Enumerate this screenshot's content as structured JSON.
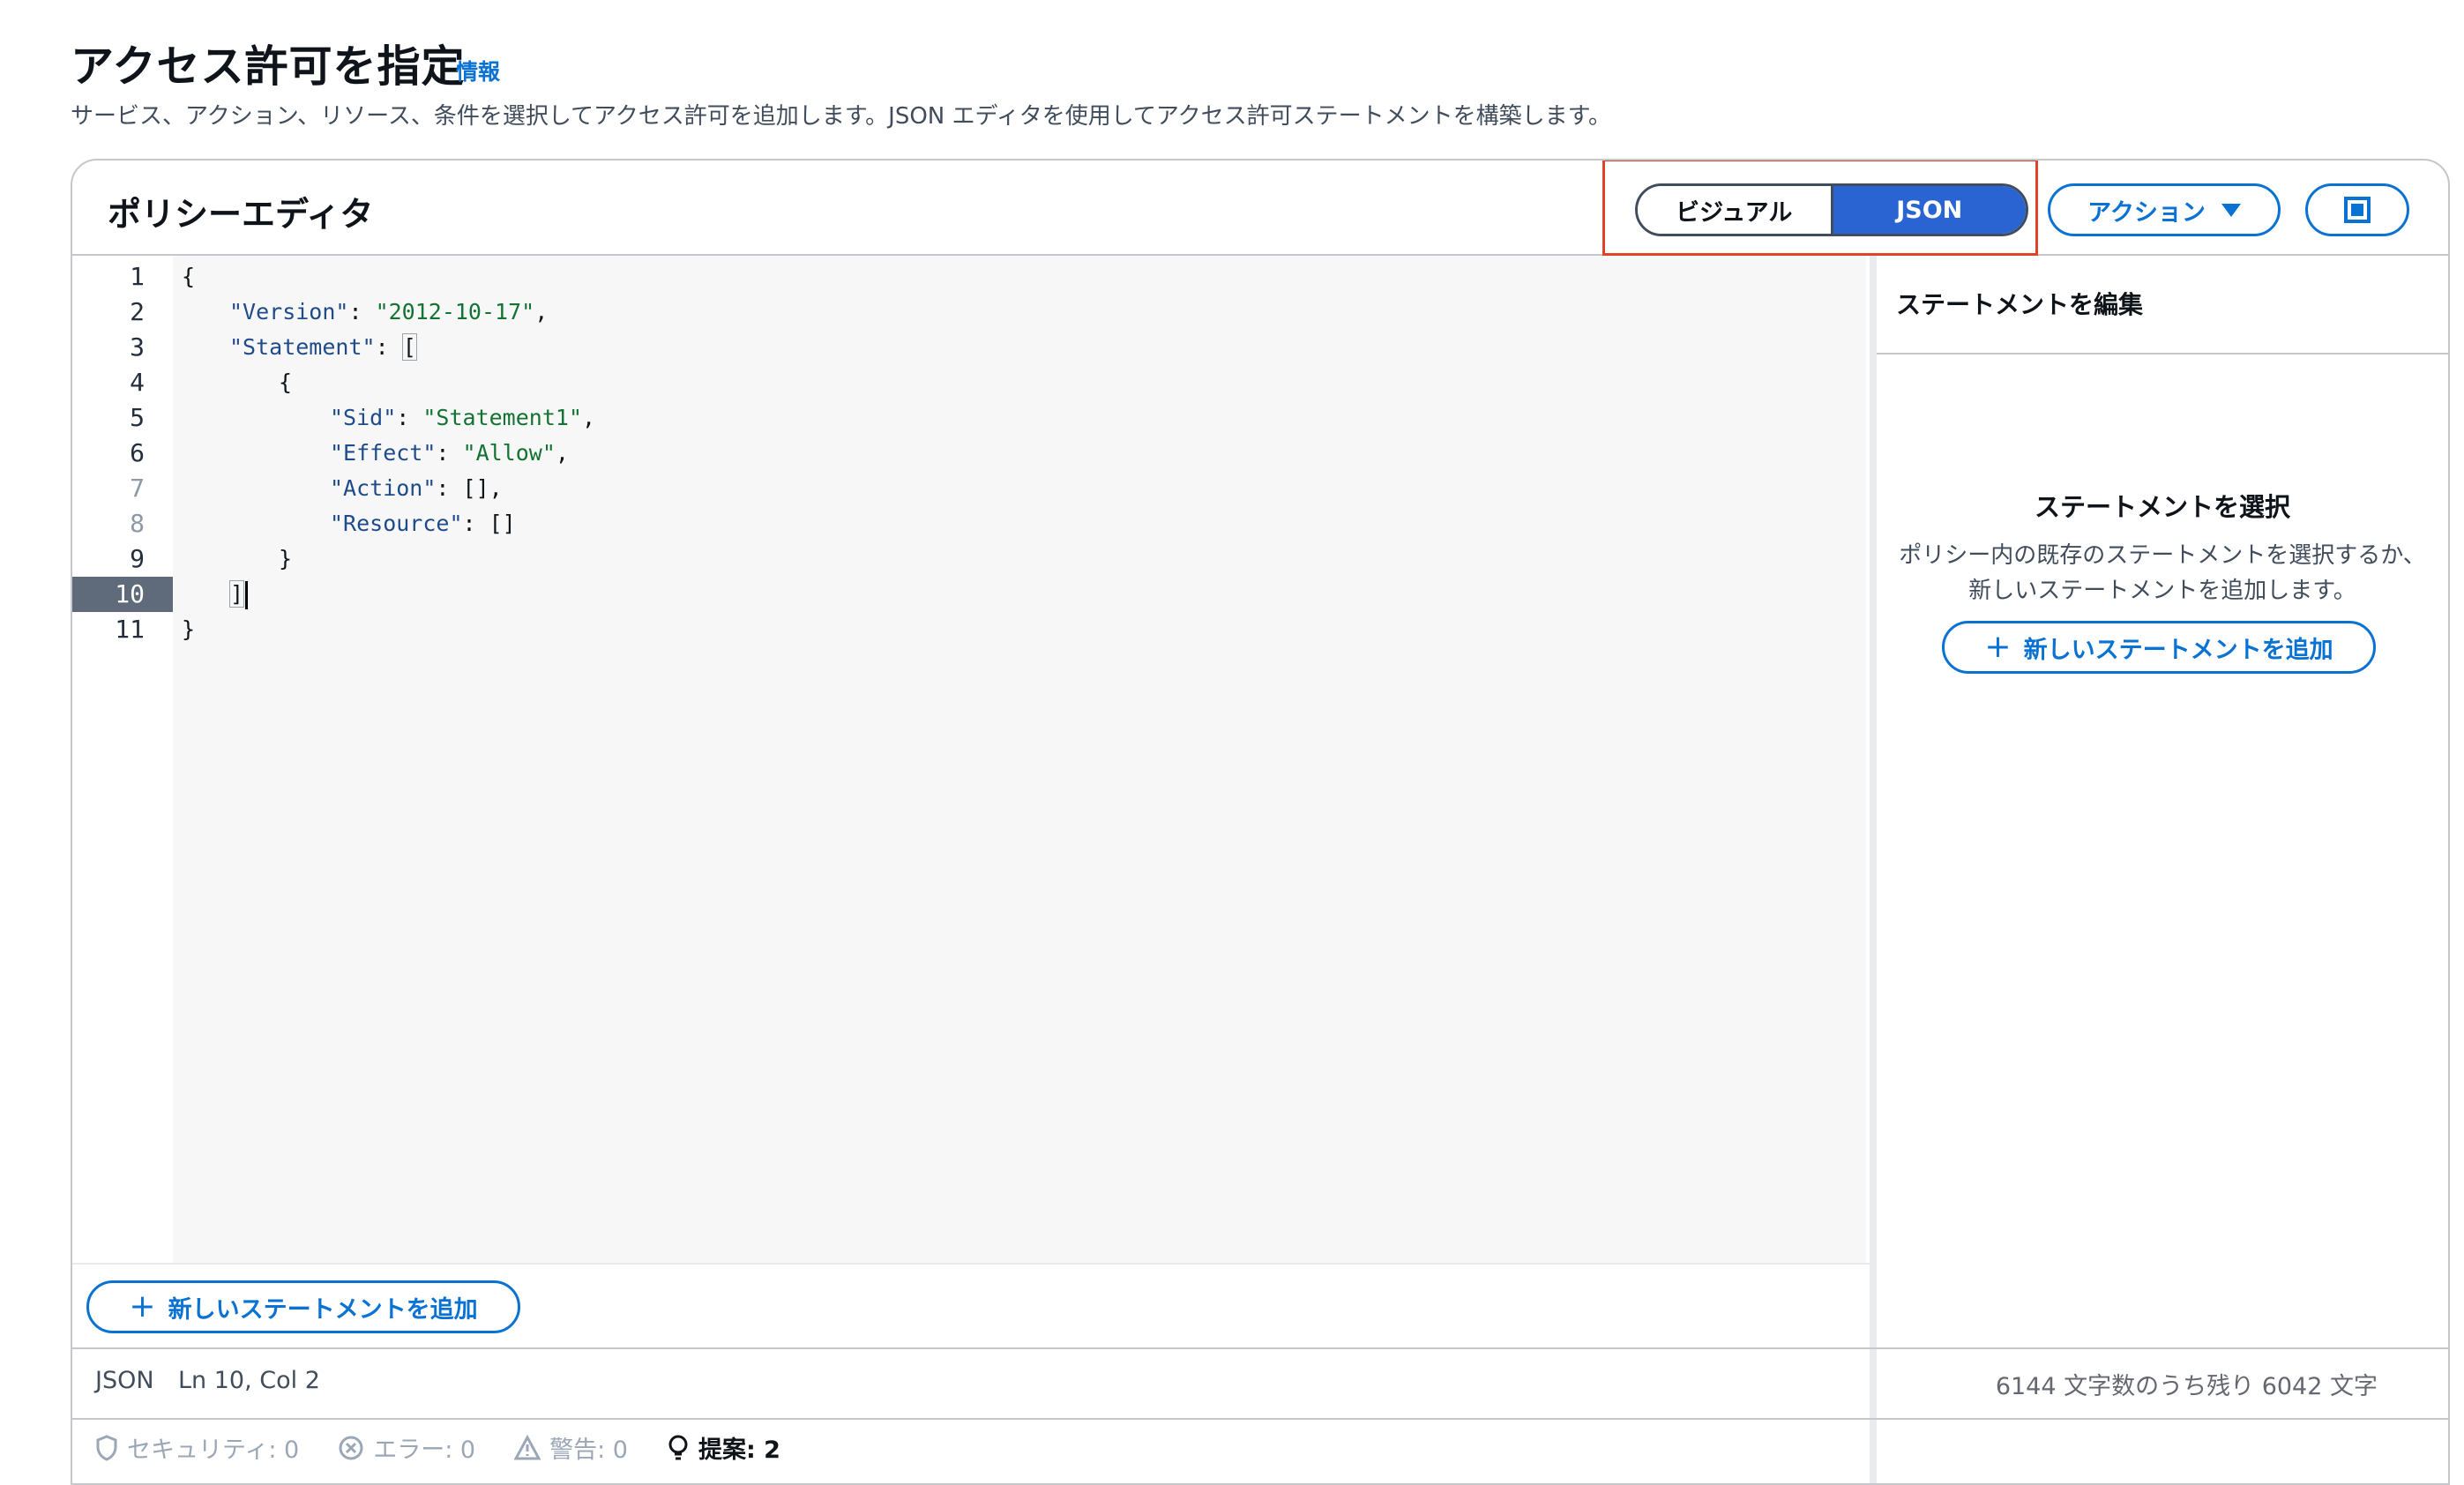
{
  "page": {
    "title": "アクセス許可を指定",
    "info_link": "情報",
    "description": "サービス、アクション、リソース、条件を選択してアクセス許可を追加します。JSON エディタを使用してアクセス許可ステートメントを構築します。"
  },
  "editor": {
    "title": "ポリシーエディタ",
    "mode_toggle": {
      "options": [
        "ビジュアル",
        "JSON"
      ],
      "selected": "JSON"
    },
    "actions_label": "アクション",
    "line_numbers": [
      "1",
      "2",
      "3",
      "4",
      "5",
      "6",
      "7",
      "8",
      "9",
      "10",
      "11"
    ],
    "active_line": "10",
    "code": {
      "open_brace": "{",
      "version_key": "\"Version\"",
      "version_value": "\"2012-10-17\"",
      "statement_key": "\"Statement\"",
      "sid_key": "\"Sid\"",
      "sid_value": "\"Statement1\"",
      "effect_key": "\"Effect\"",
      "effect_value": "\"Allow\"",
      "action_key": "\"Action\"",
      "resource_key": "\"Resource\"",
      "close_brace": "}"
    },
    "add_statement_label": "新しいステートメントを追加"
  },
  "side_panel": {
    "title": "ステートメントを編集",
    "empty_title": "ステートメントを選択",
    "empty_description": "ポリシー内の既存のステートメントを選択するか、新しいステートメントを追加します。",
    "add_statement_label": "新しいステートメントを追加"
  },
  "status_bar": {
    "language": "JSON",
    "position": "Ln 10, Col 2",
    "char_count": "6144 文字数のうち残り 6042 文字"
  },
  "validation": {
    "security": "セキュリティ: 0",
    "errors": "エラー: 0",
    "warnings": "警告: 0",
    "suggestions": "提案: 2"
  },
  "colors": {
    "accent": "#0972d3",
    "toggle_selected": "#2a64d3",
    "highlight_border": "#e0432a",
    "string": "#137333",
    "key": "#1f4b8a"
  }
}
